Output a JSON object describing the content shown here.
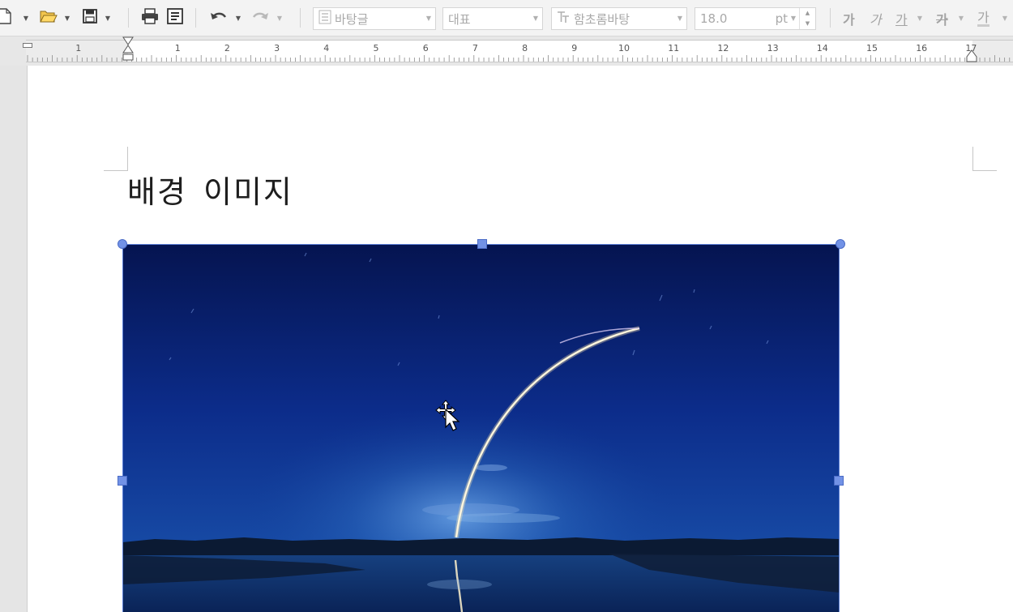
{
  "toolbar": {
    "style_combo": {
      "value": "바탕글"
    },
    "lang_combo": {
      "value": "대표"
    },
    "font_combo": {
      "value": "함초롬바탕"
    },
    "size_combo": {
      "value": "18.0",
      "unit": "pt"
    },
    "format": {
      "bold": "가",
      "italic": "가",
      "underline": "가",
      "strike": "가",
      "color": "가"
    }
  },
  "ruler": {
    "labels": [
      "1",
      "1",
      "2",
      "3",
      "4",
      "5",
      "6",
      "7",
      "8",
      "9",
      "10",
      "11",
      "12",
      "13",
      "14",
      "15",
      "16",
      "17"
    ]
  },
  "document": {
    "title": "배경 이미지"
  },
  "image": {
    "description_icon": "rocket-launch-night-photo-icon",
    "colors": {
      "sky_top": "#06154f",
      "sky_mid": "#0f3192",
      "horizon": "#1b4a9a",
      "trail": "#fff6d8"
    }
  },
  "selection": {
    "handle_color": "#7292e6"
  },
  "cursor": {
    "icon": "move-cursor-icon"
  }
}
